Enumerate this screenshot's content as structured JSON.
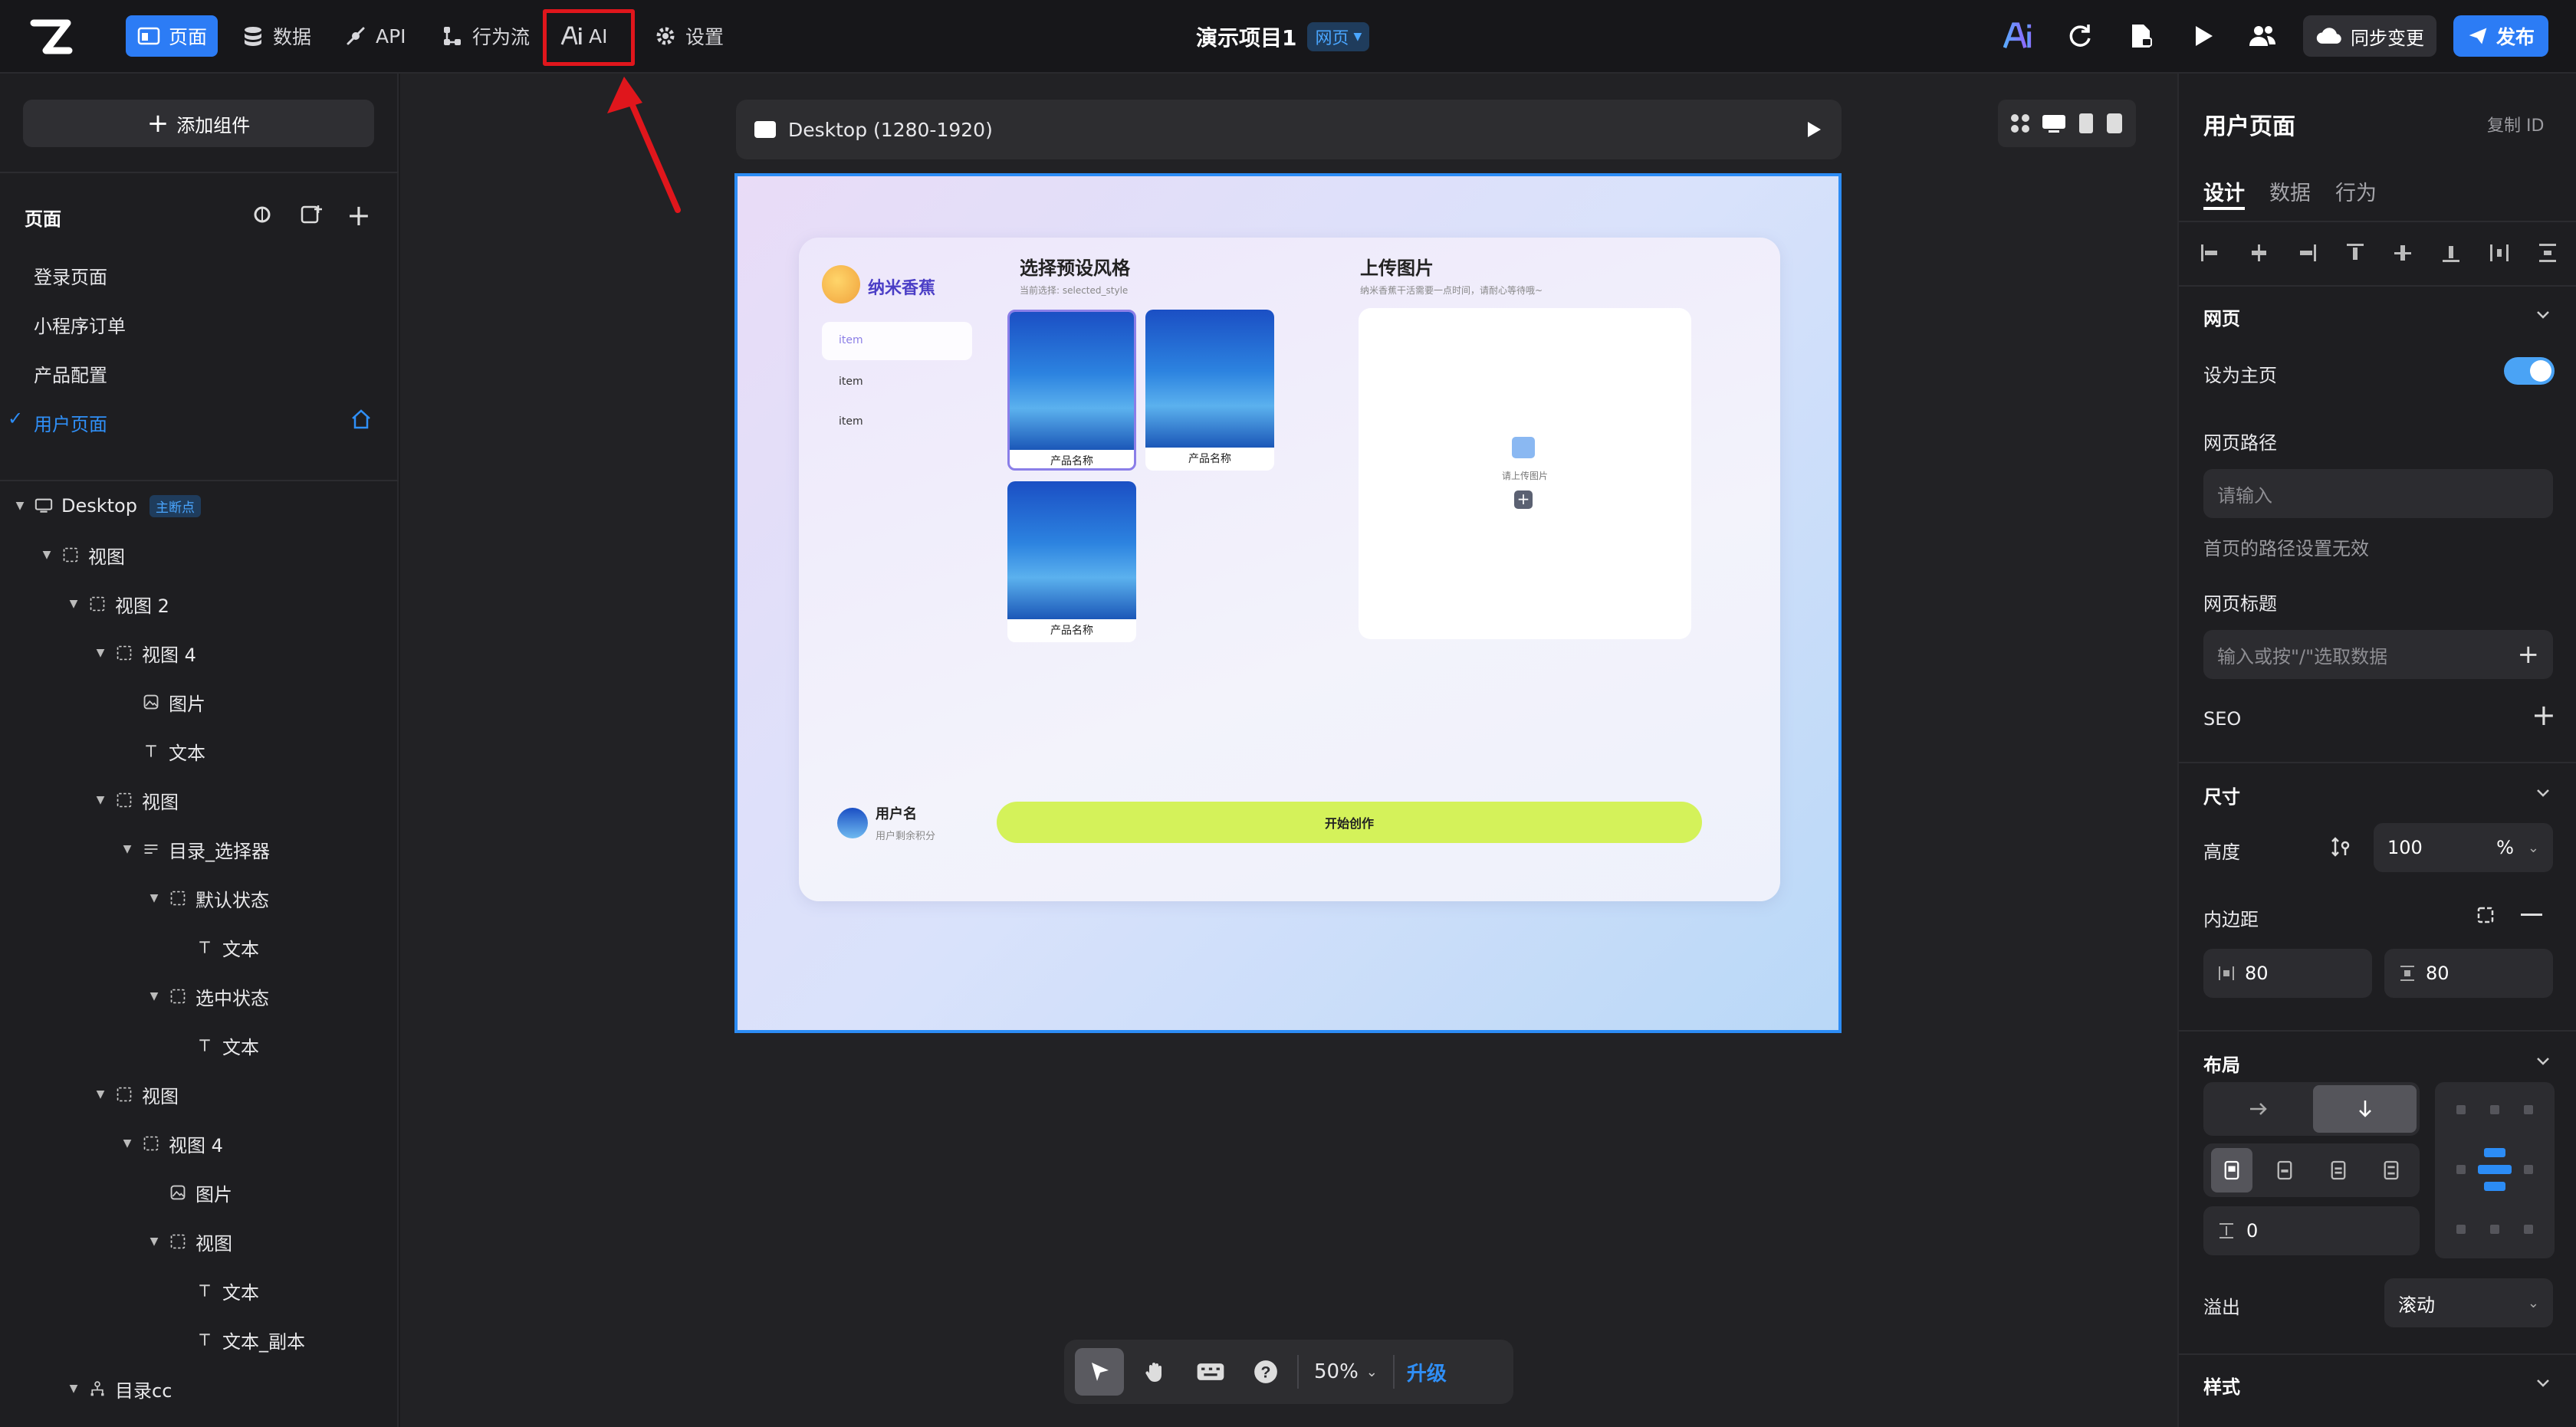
{
  "topbar": {
    "nav": [
      {
        "label": "页面",
        "icon": "page-icon"
      },
      {
        "label": "数据",
        "icon": "database-icon"
      },
      {
        "label": "API",
        "icon": "api-icon"
      },
      {
        "label": "行为流",
        "icon": "flow-icon"
      },
      {
        "label": "AI",
        "icon": "ai-icon"
      },
      {
        "label": "设置",
        "icon": "gear-icon"
      }
    ],
    "project_title": "演示项目1",
    "project_badge": "网页",
    "sync_label": "同步变更",
    "publish_label": "发布"
  },
  "left": {
    "add_component": "添加组件",
    "pages_title": "页面",
    "pages": [
      "登录页面",
      "小程序订单",
      "产品配置",
      "用户页面"
    ],
    "active_page_index": 3,
    "tree": [
      {
        "label": "Desktop",
        "badge": "主断点",
        "depth": 0,
        "icon": "desktop-icon",
        "caret": true
      },
      {
        "label": "视图",
        "depth": 1,
        "icon": "view-icon",
        "caret": true
      },
      {
        "label": "视图 2",
        "depth": 2,
        "icon": "view-icon",
        "caret": true
      },
      {
        "label": "视图 4",
        "depth": 3,
        "icon": "view-icon",
        "caret": true
      },
      {
        "label": "图片",
        "depth": 4,
        "icon": "image-icon",
        "caret": false
      },
      {
        "label": "文本",
        "depth": 4,
        "icon": "text-icon",
        "caret": false
      },
      {
        "label": "视图",
        "depth": 3,
        "icon": "view-icon",
        "caret": true
      },
      {
        "label": "目录_选择器",
        "depth": 4,
        "icon": "selector-icon",
        "caret": true
      },
      {
        "label": "默认状态",
        "depth": 5,
        "icon": "view-icon",
        "caret": true
      },
      {
        "label": "文本",
        "depth": 6,
        "icon": "text-icon",
        "caret": false
      },
      {
        "label": "选中状态",
        "depth": 5,
        "icon": "view-icon",
        "caret": true
      },
      {
        "label": "文本",
        "depth": 6,
        "icon": "text-icon",
        "caret": false
      },
      {
        "label": "视图",
        "depth": 3,
        "icon": "view-icon",
        "caret": true
      },
      {
        "label": "视图 4",
        "depth": 4,
        "icon": "view-icon",
        "caret": true
      },
      {
        "label": "图片",
        "depth": 5,
        "icon": "image-icon",
        "caret": false
      },
      {
        "label": "视图",
        "depth": 5,
        "icon": "view-icon",
        "caret": true
      },
      {
        "label": "文本",
        "depth": 6,
        "icon": "text-icon",
        "caret": false
      },
      {
        "label": "文本_副本",
        "depth": 6,
        "icon": "text-icon",
        "caret": false
      },
      {
        "label": "目录cc",
        "depth": 2,
        "icon": "directory-icon",
        "caret": true
      }
    ]
  },
  "canvas": {
    "device_label": "Desktop (1280-1920)",
    "zoom": "50%",
    "upgrade": "升级"
  },
  "preview": {
    "brand": "纳米香蕉",
    "menu": [
      "item",
      "item",
      "item"
    ],
    "style_title": "选择预设风格",
    "style_sub": "当前选择: selected_style",
    "products": [
      "产品名称",
      "产品名称",
      "产品名称"
    ],
    "upload_title": "上传图片",
    "upload_sub": "纳米香蕉干活需要一点时间，请耐心等待哦~",
    "upload_hint": "请上传图片",
    "user_name": "用户名",
    "user_sub": "用户剩余积分",
    "cta": "开始创作"
  },
  "right": {
    "title": "用户页面",
    "copy_id": "复制 ID",
    "tabs": [
      "设计",
      "数据",
      "行为"
    ],
    "section_page": "网页",
    "set_home": "设为主页",
    "set_home_on": true,
    "path_label": "网页路径",
    "path_placeholder": "请输入",
    "path_note": "首页的路径设置无效",
    "page_title_label": "网页标题",
    "page_title_placeholder": "输入或按\"/\"选取数据",
    "seo": "SEO",
    "size_head": "尺寸",
    "height_label": "高度",
    "height_value": "100",
    "height_unit": "%",
    "padding_label": "内边距",
    "padding_left": "80",
    "padding_top": "80",
    "layout_head": "布局",
    "gap_value": "0",
    "overflow_label": "溢出",
    "overflow_value": "滚动",
    "style_head": "样式"
  },
  "colors": {
    "accent": "#2c7cf5",
    "highlight": "#e0161c",
    "cta": "#d4f25a"
  }
}
